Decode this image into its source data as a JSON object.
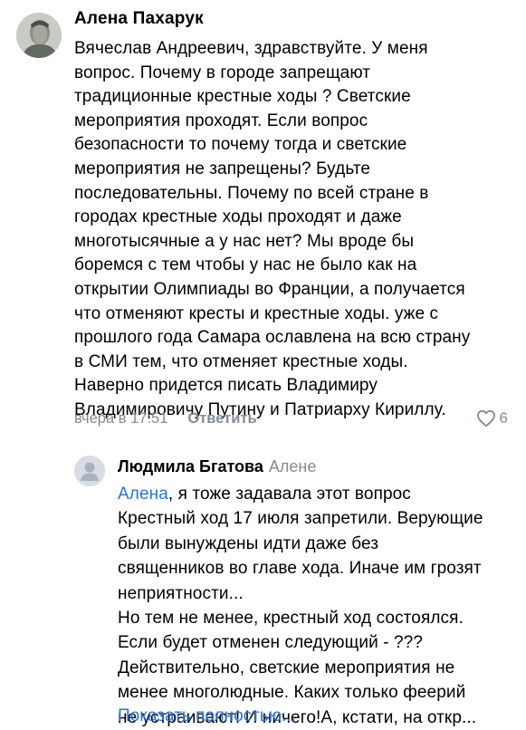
{
  "comment": {
    "author": "Алена Пахарук",
    "text": "Вячеслав Андреевич, здравствуйте.  У меня\nвопрос. Почему в городе запрещают\nтрадиционные крестные ходы ? Светские\nмероприятия проходят. Если вопрос\nбезопасности то почему тогда и светские\nмероприятия не запрещены?  Будьте\nпоследовательны. Почему по всей стране в\nгородах крестные ходы проходят и даже\nмноготысячные а у нас нет?   Мы вроде бы\nборемся с тем чтобы у нас не было как на\nоткрытии Олимпиады во Франции, а получается\nчто отменяют кресты и крестные ходы. уже с\nпрошлого года Самара ославлена на всю страну\nв СМИ тем, что отменяет крестные ходы.\nНаверно придется писать Владимиру\nВладимировичу  Путину и Патриарху Кириллу.",
    "time": "вчера в 17:51",
    "reply_label": "Ответить",
    "likes": "6",
    "like_icon": "heart-icon"
  },
  "reply": {
    "author": "Людмила Бгатова",
    "reply_to": "Алене",
    "mention": "Алена",
    "text": ", я тоже задавала этот вопрос\nКрестный ход 17 июля запретили. Верующие\nбыли вынуждены идти даже без\nсвященников во главе хода. Иначе им грозят\nнеприятности...\nНо тем не менее, крестный ход состоялся.\nЕсли будет отменен следующий - ???\nДействительно, светские мероприятия не\nменее многолюдные. Каких только феерий\nне устраивают! И ничего!А, кстати, на откр...",
    "show_more": "Показать полностью...",
    "avatar_icon": "default-user-avatar-icon"
  }
}
